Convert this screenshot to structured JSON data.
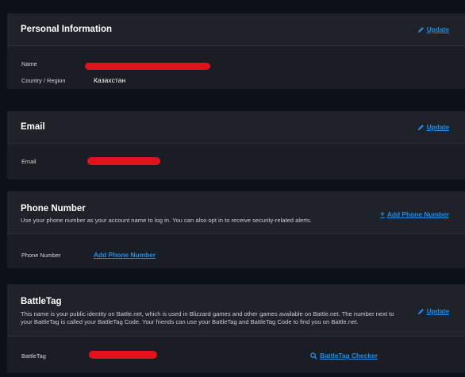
{
  "personal": {
    "title": "Personal Information",
    "update_label": "Update",
    "name_label": "Name",
    "country_label": "Country / Region",
    "country_value": "Казахстан"
  },
  "email": {
    "title": "Email",
    "update_label": "Update",
    "email_label": "Email"
  },
  "phone": {
    "title": "Phone Number",
    "description": "Use your phone number as your account name to log in. You can also opt in to receive security-related alerts.",
    "add_label": "Add Phone Number",
    "phone_label": "Phone Number",
    "row_add_label": "Add Phone Number"
  },
  "battletag": {
    "title": "BattleTag",
    "description": "This name is your public identity on Battle.net, which is used in Blizzard games and other games available on Battle.net. The number next to your BattleTag is called your BattleTag Code. Your friends can use your BattleTag and BattleTag Code to find you on Battle.net.",
    "update_label": "Update",
    "battletag_label": "BattleTag",
    "checker_label": "BattleTag Checker"
  },
  "colors": {
    "accent": "#1e8ee8",
    "redaction": "#e0131b"
  },
  "icons": [
    "pencil-icon",
    "plus-icon",
    "search-icon"
  ]
}
